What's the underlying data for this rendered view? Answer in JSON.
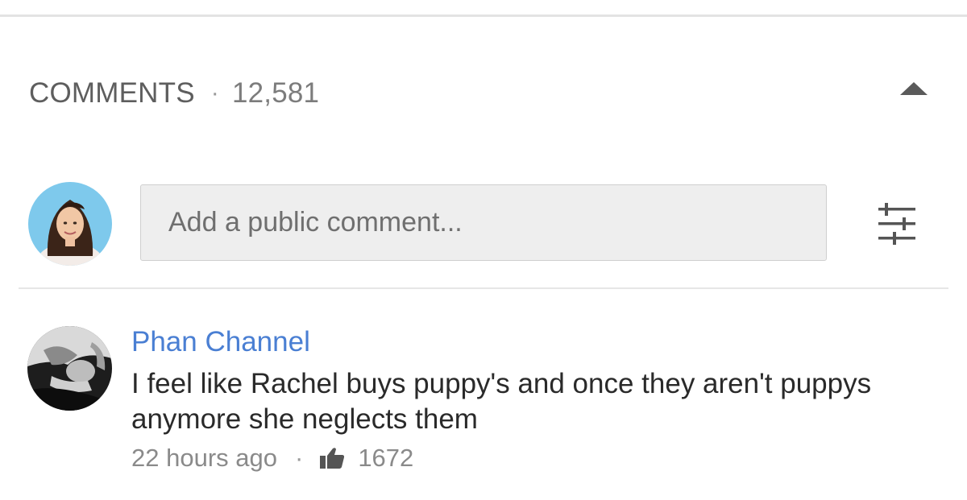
{
  "comments_section": {
    "title": "COMMENTS",
    "separator": "·",
    "count": "12,581"
  },
  "composer": {
    "placeholder": "Add a public comment..."
  },
  "comments": [
    {
      "author": "Phan Channel",
      "text": "I feel like Rachel buys puppy's and once they aren't puppys anymore she neglects them",
      "time": "22 hours ago",
      "separator": "·",
      "likes": "1672"
    }
  ],
  "colors": {
    "author_link": "#4a7fd3",
    "input_bg": "#eeeeee"
  },
  "icons": {
    "collapse": "triangle-up-icon",
    "filter": "sliders-icon",
    "like": "thumbs-up-icon"
  }
}
